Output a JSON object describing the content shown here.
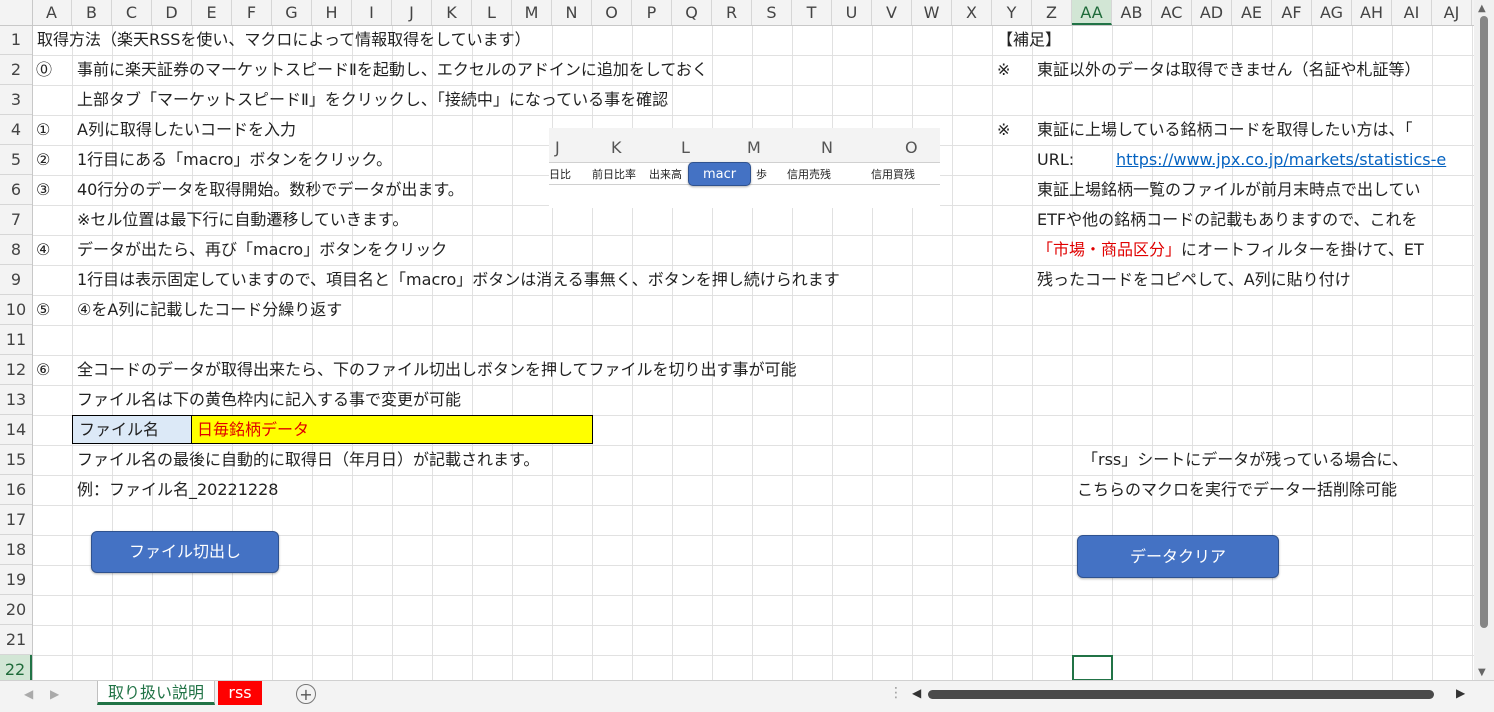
{
  "columns": [
    "A",
    "B",
    "C",
    "D",
    "E",
    "F",
    "G",
    "H",
    "I",
    "J",
    "K",
    "L",
    "M",
    "N",
    "O",
    "P",
    "Q",
    "R",
    "S",
    "T",
    "U",
    "V",
    "W",
    "X",
    "Y",
    "Z",
    "AA",
    "AB",
    "AC",
    "AD",
    "AE",
    "AF",
    "AG",
    "AH",
    "AI",
    "AJ"
  ],
  "active_column": "AA",
  "rows": [
    "1",
    "2",
    "3",
    "4",
    "5",
    "6",
    "7",
    "8",
    "9",
    "10",
    "11",
    "12",
    "13",
    "14",
    "15",
    "16",
    "17",
    "18",
    "19",
    "20",
    "21",
    "22"
  ],
  "active_row": "22",
  "content": {
    "r1": "取得方法（楽天RSSを使い、マクロによって情報取得をしています）",
    "r2_mark": "⓪",
    "r2": "事前に楽天証券のマーケットスピードⅡを起動し、エクセルのアドインに追加をしておく",
    "r3": "上部タブ「マーケットスピードⅡ」をクリックし、「接続中」になっている事を確認",
    "r4_mark": "①",
    "r4": "A列に取得したいコードを入力",
    "r5_mark": "②",
    "r5": "1行目にある「macro」ボタンをクリック。",
    "r6_mark": "③",
    "r6": "40行分のデータを取得開始。数秒でデータが出ます。",
    "r7": "※セル位置は最下行に自動遷移していきます。",
    "r8_mark": "④",
    "r8": "データが出たら、再び「macro」ボタンをクリック",
    "r9": "1行目は表示固定していますので、項目名と「macro」ボタンは消える事無く、ボタンを押し続けられます",
    "r10_mark": "⑤",
    "r10": "④をA列に記載したコード分繰り返す",
    "r12_mark": "⑥",
    "r12": "全コードのデータが取得出来たら、下のファイル切出しボタンを押してファイルを切り出す事が可能",
    "r13": "ファイル名は下の黄色枠内に記入する事で変更が可能",
    "filename_label": "ファイル名",
    "filename_value": "日毎銘柄データ",
    "r15": "ファイル名の最後に自動的に取得日（年月日）が記載されます。",
    "r16": "例：ファイル名_20221228"
  },
  "notes": {
    "header": "【補足】",
    "mark1": "※",
    "line2": "東証以外のデータは取得できません（名証や札証等）",
    "mark2": "※",
    "line4": "東証に上場している銘柄コードを取得したい方は、「",
    "url_label": "URL:",
    "url": "https://www.jpx.co.jp/markets/statistics-e",
    "line6": "東証上場銘柄一覧のファイルが前月末時点で出してい",
    "line7": "ETFや他の銘柄コードの記載もありますので、これを",
    "line8_red": "「市場・商品区分」",
    "line8": "にオートフィルターを掛けて、ET",
    "line9": "残ったコードをコピペして、A列に貼り付け",
    "clear_note1": "「rss」シートにデータが残っている場合に、",
    "clear_note2": "こちらのマクロを実行でデーター括削除可能"
  },
  "buttons": {
    "export": "ファイル切出し",
    "clear": "データクリア"
  },
  "picture": {
    "cols": [
      "J",
      "K",
      "L",
      "M",
      "N",
      "O"
    ],
    "labels": [
      "日比",
      "前日比率",
      "出来高",
      "歩",
      "信用売残",
      "信用買残"
    ],
    "macro_button": "macr"
  },
  "tabs": [
    "取り扱い説明",
    "rss"
  ],
  "colors": {
    "accent": "#217346",
    "button": "#4472c4",
    "highlight": "#ffff00",
    "red_tab": "#ff0000"
  }
}
